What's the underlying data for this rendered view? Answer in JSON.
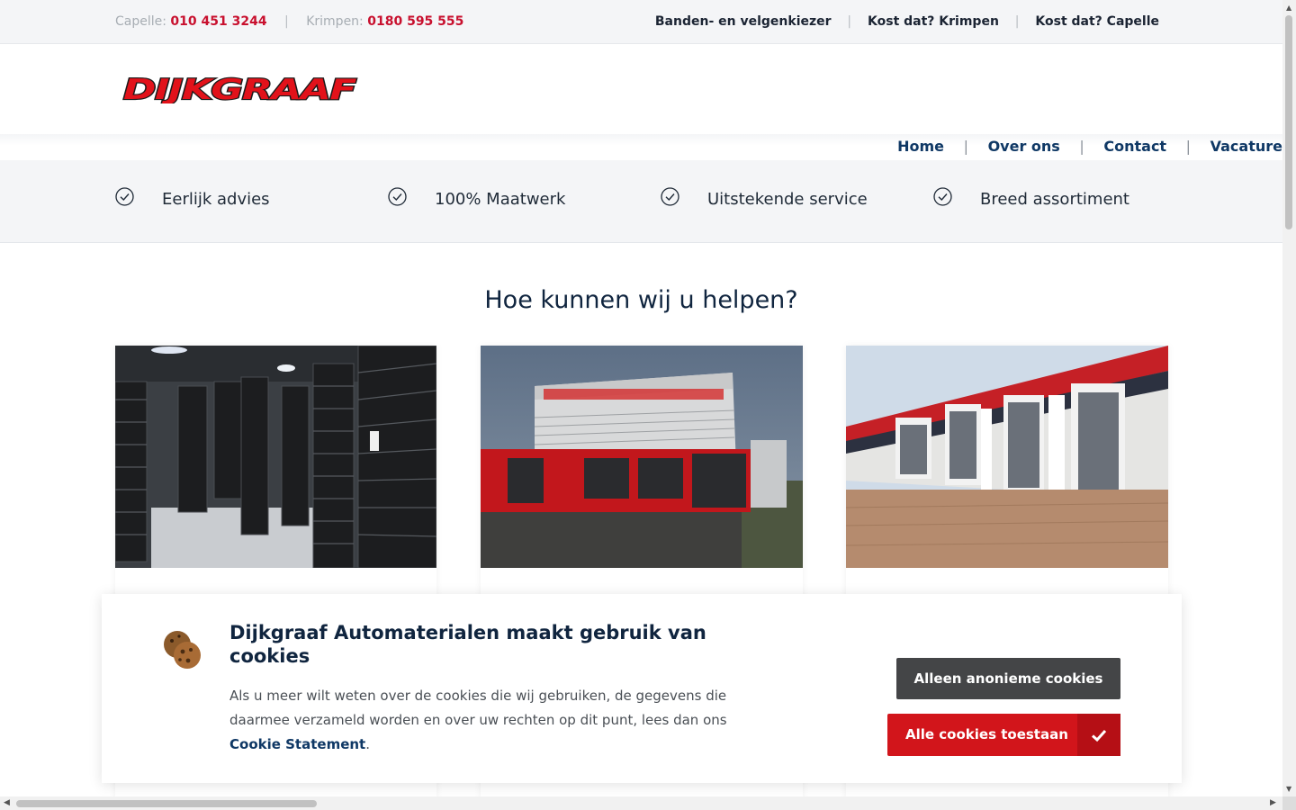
{
  "topbar": {
    "capelle_label": "Capelle:",
    "capelle_phone": "010 451 3244",
    "krimpen_label": "Krimpen:",
    "krimpen_phone": "0180 595 555",
    "separator": "|",
    "links": [
      "Banden- en velgenkiezer",
      "Kost dat? Krimpen",
      "Kost dat? Capelle"
    ]
  },
  "logo": {
    "text": "DIJKGRAAF"
  },
  "nav": {
    "items": [
      "Home",
      "Over ons",
      "Contact",
      "Vacature"
    ]
  },
  "usps": [
    "Eerlijk advies",
    "100% Maatwerk",
    "Uitstekende service",
    "Breed assortiment"
  ],
  "section": {
    "title": "Hoe kunnen wij u helpen?"
  },
  "cards": [
    {
      "image": "tire-warehouse-photo"
    },
    {
      "image": "storefront-photo"
    },
    {
      "image": "workshop-garage-photo"
    }
  ],
  "cookie": {
    "title": "Dijkgraaf Automaterialen maakt gebruik van cookies",
    "body": "Als u meer wilt weten over de cookies die wij gebruiken, de gegevens die daarmee verzameld worden en over uw rechten op dit punt, lees dan ons",
    "link": "Cookie Statement",
    "period": ".",
    "btn_anonymous": "Alleen anonieme cookies",
    "btn_all": "Alle cookies toestaan"
  },
  "colors": {
    "brand_red": "#d2151b",
    "navy": "#0f3865",
    "dark_button": "#444547"
  }
}
